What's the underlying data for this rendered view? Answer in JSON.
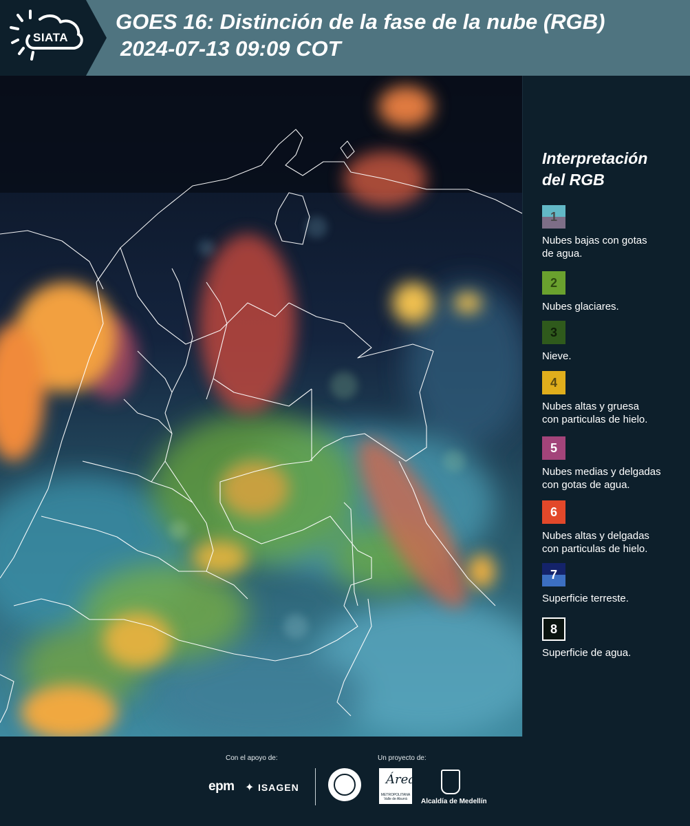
{
  "header": {
    "logo_text": "SIATA",
    "title_line1": "GOES 16: Distinción de la fase de la nube (RGB)",
    "title_line2": "2024-07-13 09:09 COT"
  },
  "legend": {
    "title_line1": "Interpretación",
    "title_line2": "del RGB",
    "items": [
      {
        "number": "1",
        "color_top": "#62b8c6",
        "color_bottom": "#7d6e87",
        "number_color": "#4a4a4a",
        "label_lines": [
          "Nubes bajas con gotas",
          "de agua."
        ]
      },
      {
        "number": "2",
        "color_top": "#6aa12e",
        "color_bottom": "#6aa12e",
        "number_color": "#2d4a10",
        "label_lines": [
          "Nubes glaciares."
        ]
      },
      {
        "number": "3",
        "color_top": "#2f5a1c",
        "color_bottom": "#2f5a1c",
        "number_color": "#0f1f08",
        "label_lines": [
          "Nieve."
        ]
      },
      {
        "number": "4",
        "color_top": "#e0ae1c",
        "color_bottom": "#e0ae1c",
        "number_color": "#5a4a10",
        "label_lines": [
          "Nubes altas y gruesa",
          "con particulas de hielo."
        ]
      },
      {
        "number": "5",
        "color_top": "#a3447a",
        "color_bottom": "#a3447a",
        "number_color": "#ffffff",
        "label_lines": [
          "Nubes medias y delgadas",
          "con gotas de agua."
        ]
      },
      {
        "number": "6",
        "color_top": "#e2482a",
        "color_bottom": "#e2482a",
        "number_color": "#ffffff",
        "label_lines": [
          "Nubes altas y delgadas",
          "con particulas de hielo."
        ]
      },
      {
        "number": "7",
        "color_top": "#14236a",
        "color_bottom": "#3c6fc2",
        "number_color": "#ffffff",
        "label_lines": [
          "Superficie terreste."
        ]
      },
      {
        "number": "8",
        "color_top": "#0a140f",
        "color_bottom": "#0a140f",
        "number_color": "#ffffff",
        "label_lines": [
          "Superficie de agua."
        ]
      }
    ]
  },
  "footer": {
    "support_caption": "Con el apoyo de:",
    "project_caption": "Un proyecto de:",
    "sponsor1": "epm",
    "sponsor2": "ISAGEN",
    "area_script": "Área",
    "area_sub": "METROPOLITANA Valle de Aburrá",
    "alcaldia": "Alcaldía de Medellín"
  },
  "colors": {
    "header_bg": "#4f7480",
    "page_bg": "#0d1f2b"
  }
}
